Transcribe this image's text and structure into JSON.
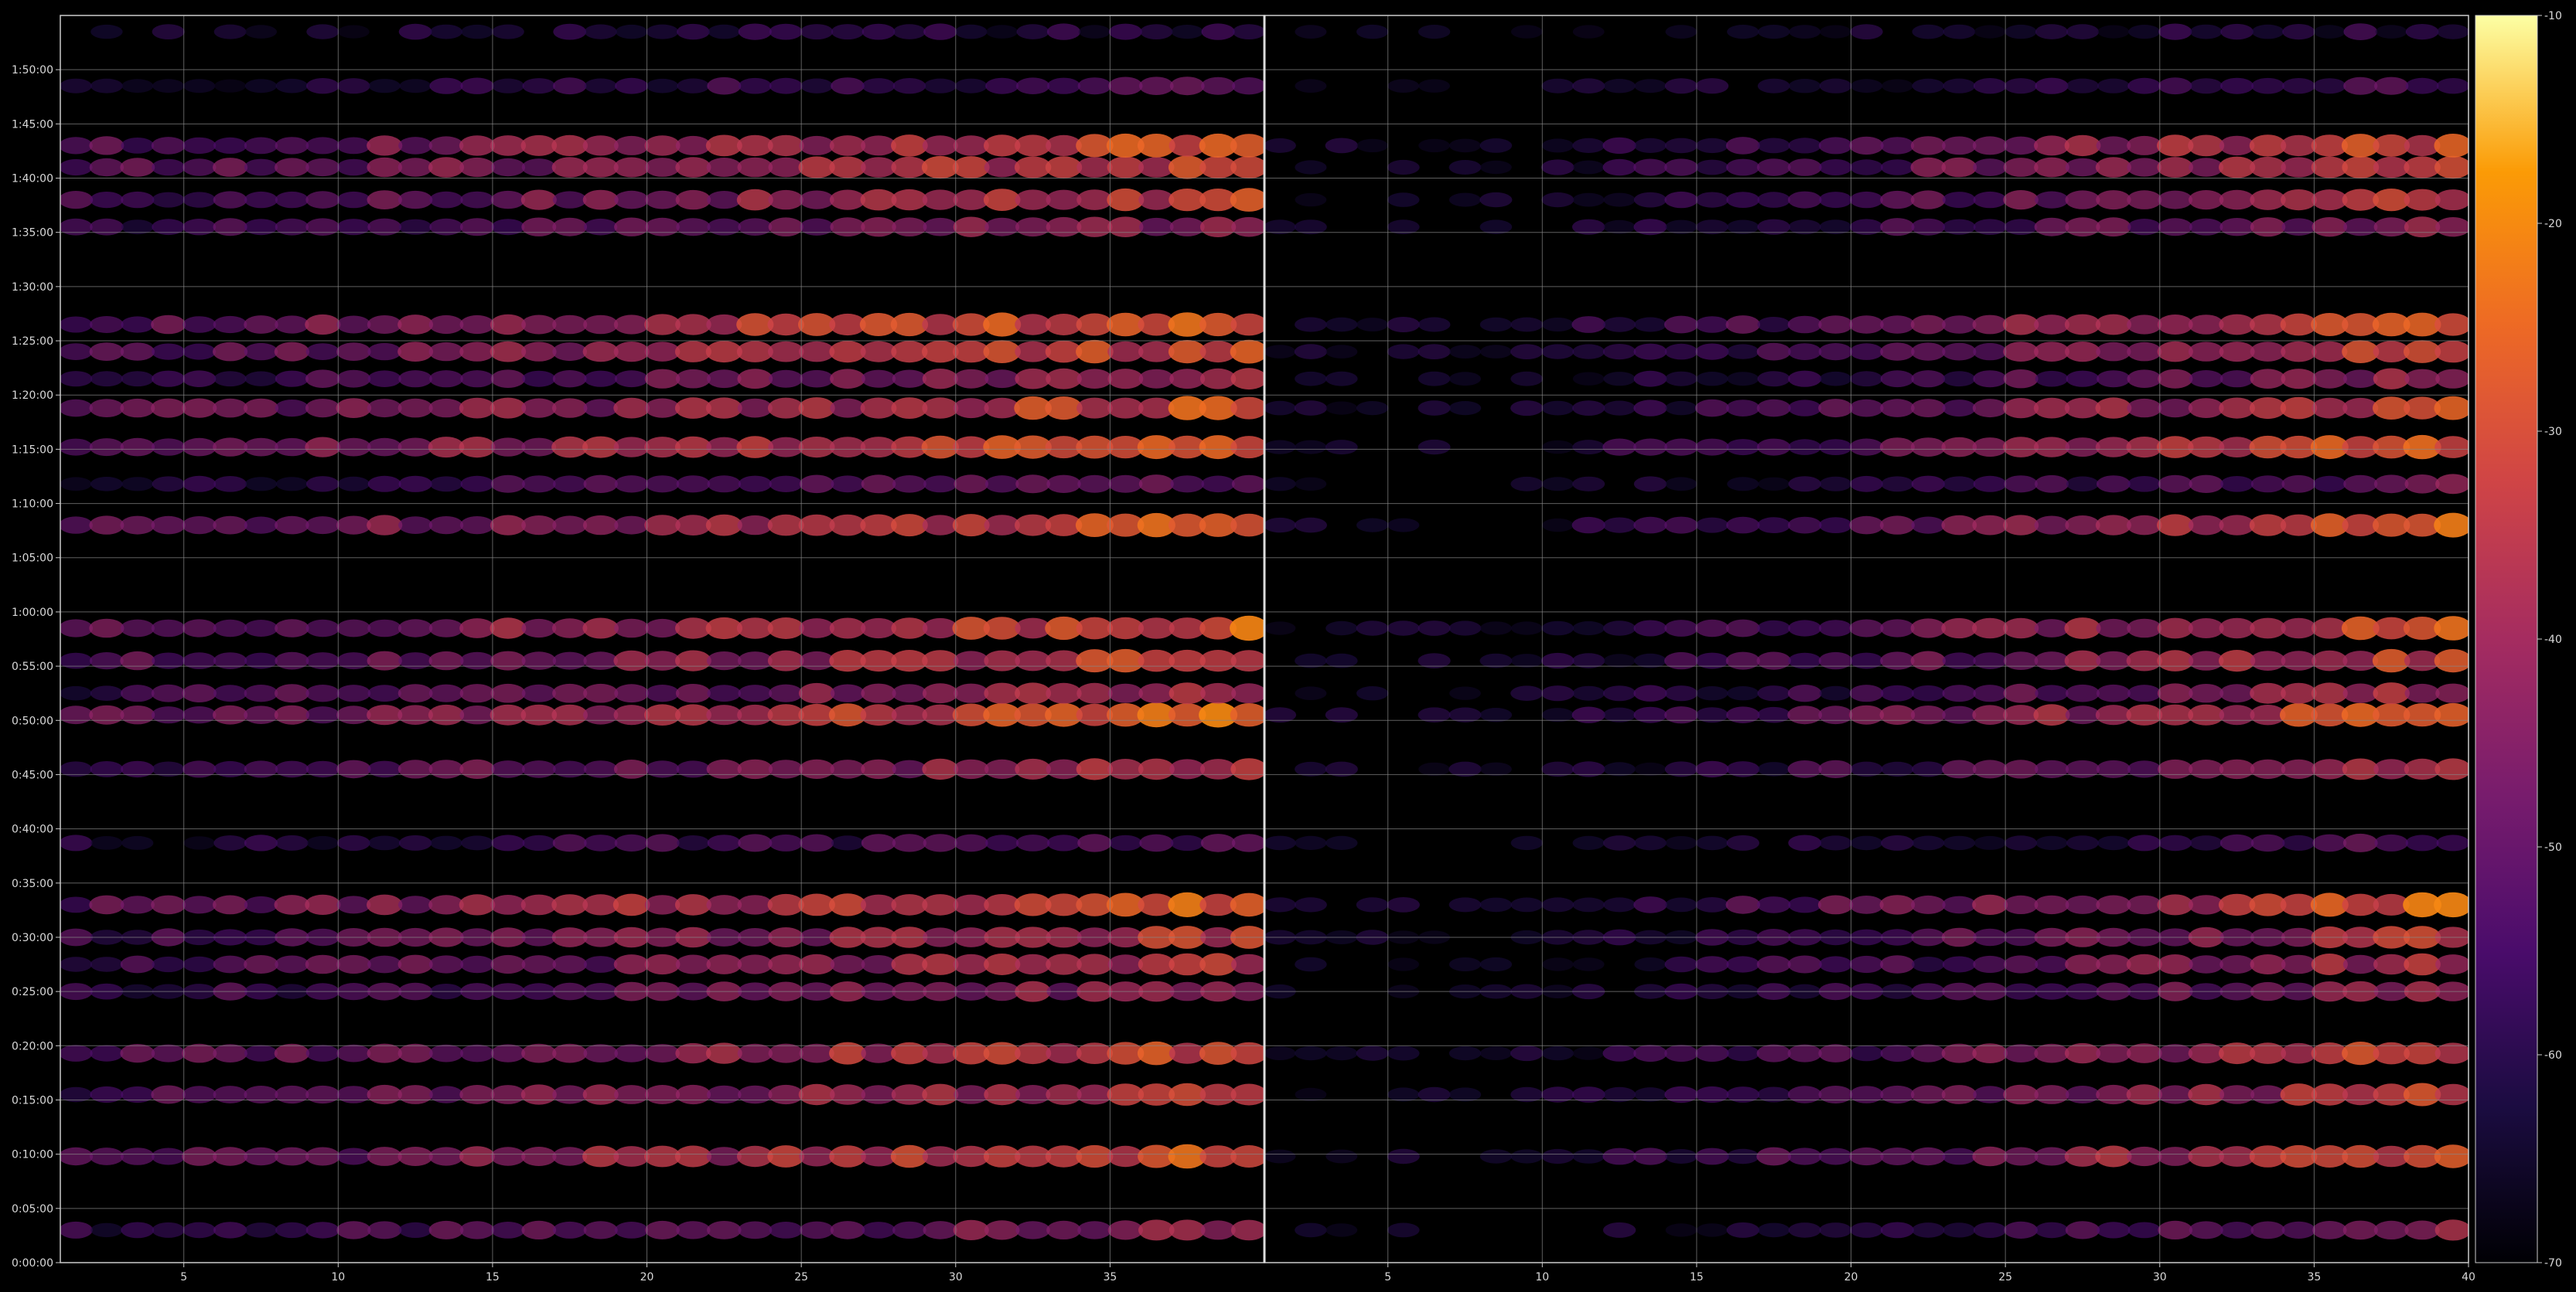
{
  "chart_data": {
    "type": "heatmap",
    "title": "",
    "xlabel": "",
    "ylabel": "",
    "colormap": "inferno",
    "background": "#000000",
    "grid": true,
    "panels": [
      {
        "name": "",
        "xlim": [
          1,
          40
        ],
        "xticks": [
          "5",
          "10",
          "15",
          "20",
          "25",
          "30",
          "35"
        ],
        "xtick_values": [
          5,
          10,
          15,
          20,
          25,
          30,
          35
        ],
        "columns_from": 1,
        "columns_to": 39,
        "ramp_from_column": 1,
        "ramp_min": 0.45
      },
      {
        "name": "",
        "xlim": [
          1,
          40
        ],
        "xticks": [
          "5",
          "10",
          "15",
          "20",
          "25",
          "30",
          "35",
          "40"
        ],
        "xtick_values": [
          5,
          10,
          15,
          20,
          25,
          30,
          35,
          40
        ],
        "columns_from": 1,
        "columns_to": 39,
        "ramp_from_column": 10,
        "ramp_min": 0.22
      }
    ],
    "y_axis": {
      "unit": "time (h:mm:ss)",
      "range_minutes": [
        0,
        115
      ],
      "ticks": [
        "0:00:00",
        "0:05:00",
        "0:10:00",
        "0:15:00",
        "0:20:00",
        "0:25:00",
        "0:30:00",
        "0:35:00",
        "0:40:00",
        "0:45:00",
        "0:50:00",
        "0:55:00",
        "1:00:00",
        "1:05:00",
        "1:10:00",
        "1:15:00",
        "1:20:00",
        "1:25:00",
        "1:30:00",
        "1:35:00",
        "1:40:00",
        "1:45:00",
        "1:50:00"
      ],
      "tick_minutes": [
        0,
        5,
        10,
        15,
        20,
        25,
        30,
        35,
        40,
        45,
        50,
        55,
        60,
        65,
        70,
        75,
        80,
        85,
        90,
        95,
        100,
        105,
        110
      ]
    },
    "colorbar": {
      "range": [
        -70,
        -10
      ],
      "ticks": [
        "-10",
        "-20",
        "-30",
        "-40",
        "-50",
        "-60",
        "-70"
      ],
      "tick_values": [
        -10,
        -20,
        -30,
        -40,
        -50,
        -60,
        -70
      ]
    },
    "intensity_bands": [
      {
        "minute": 3.0,
        "level": -42
      },
      {
        "minute": 9.8,
        "level": -28
      },
      {
        "minute": 15.5,
        "level": -33
      },
      {
        "minute": 19.3,
        "level": -30
      },
      {
        "minute": 25.0,
        "level": -40
      },
      {
        "minute": 27.5,
        "level": -36
      },
      {
        "minute": 30.0,
        "level": -34
      },
      {
        "minute": 33.0,
        "level": -26
      },
      {
        "minute": 38.7,
        "level": -50
      },
      {
        "minute": 45.5,
        "level": -37
      },
      {
        "minute": 50.5,
        "level": -26
      },
      {
        "minute": 52.5,
        "level": -38
      },
      {
        "minute": 55.5,
        "level": -31
      },
      {
        "minute": 58.5,
        "level": -27
      },
      {
        "minute": 68.0,
        "level": -27
      },
      {
        "minute": 71.8,
        "level": -47
      },
      {
        "minute": 75.2,
        "level": -26
      },
      {
        "minute": 78.8,
        "level": -29
      },
      {
        "minute": 81.5,
        "level": -40
      },
      {
        "minute": 84.0,
        "level": -30
      },
      {
        "minute": 86.5,
        "level": -25
      },
      {
        "minute": 95.5,
        "level": -40
      },
      {
        "minute": 98.0,
        "level": -33
      },
      {
        "minute": 101.0,
        "level": -30
      },
      {
        "minute": 103.0,
        "level": -29
      },
      {
        "minute": 108.5,
        "level": -52
      },
      {
        "minute": 113.5,
        "level": -58
      }
    ]
  }
}
